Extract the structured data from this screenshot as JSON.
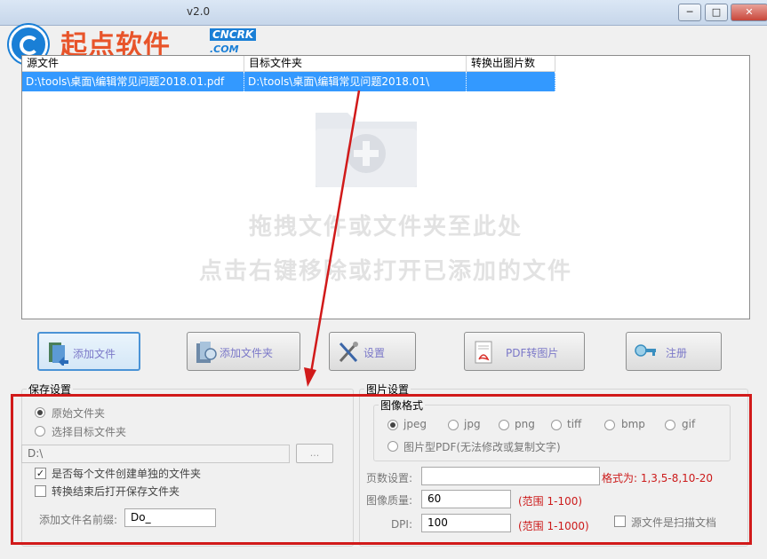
{
  "window": {
    "title": "v2.0",
    "buttons": {
      "minimize": "─",
      "maximize": "□",
      "close": "✕"
    }
  },
  "watermark": {
    "text": "起点软件",
    "badge1": "CNCRK",
    "badge2": ".COM"
  },
  "file_list": {
    "columns": [
      "源文件",
      "目标文件夹",
      "转换出图片数"
    ],
    "rows": [
      {
        "source": "D:\\tools\\桌面\\编辑常见问题2018.01.pdf",
        "target": "D:\\tools\\桌面\\编辑常见问题2018.01\\",
        "count": ""
      }
    ],
    "hint_line1": "拖拽文件或文件夹至此处",
    "hint_line2": "点击右键移除或打开已添加的文件"
  },
  "toolbar": {
    "add_file": "添加文件",
    "add_folder": "添加文件夹",
    "settings": "设置",
    "pdf_to_image": "PDF转图片",
    "register": "注册"
  },
  "save_settings": {
    "title": "保存设置",
    "opt_original": "原始文件夹",
    "opt_target": "选择目标文件夹",
    "path_value": "D:\\",
    "browse": "...",
    "check_separate": "是否每个文件创建单独的文件夹",
    "check_open": "转换结束后打开保存文件夹",
    "prefix_label": "添加文件名前缀:",
    "prefix_value": "Do_"
  },
  "image_settings": {
    "title": "图片设置",
    "format_title": "图像格式",
    "formats": [
      "jpeg",
      "jpg",
      "png",
      "tiff",
      "bmp",
      "gif"
    ],
    "pdf_option": "图片型PDF(无法修改或复制文字)",
    "pages_label": "页数设置:",
    "pages_value": "",
    "pages_hint": "格式为: 1,3,5-8,10-20",
    "quality_label": "图像质量:",
    "quality_value": "60",
    "quality_hint": "(范围 1-100)",
    "dpi_label": "DPI:",
    "dpi_value": "100",
    "dpi_hint": "(范围 1-1000)",
    "scan_label": "源文件是扫描文档"
  },
  "colors": {
    "selection": "#3399ff",
    "annotation": "#d11a1a",
    "button_text": "#7b78c8"
  }
}
